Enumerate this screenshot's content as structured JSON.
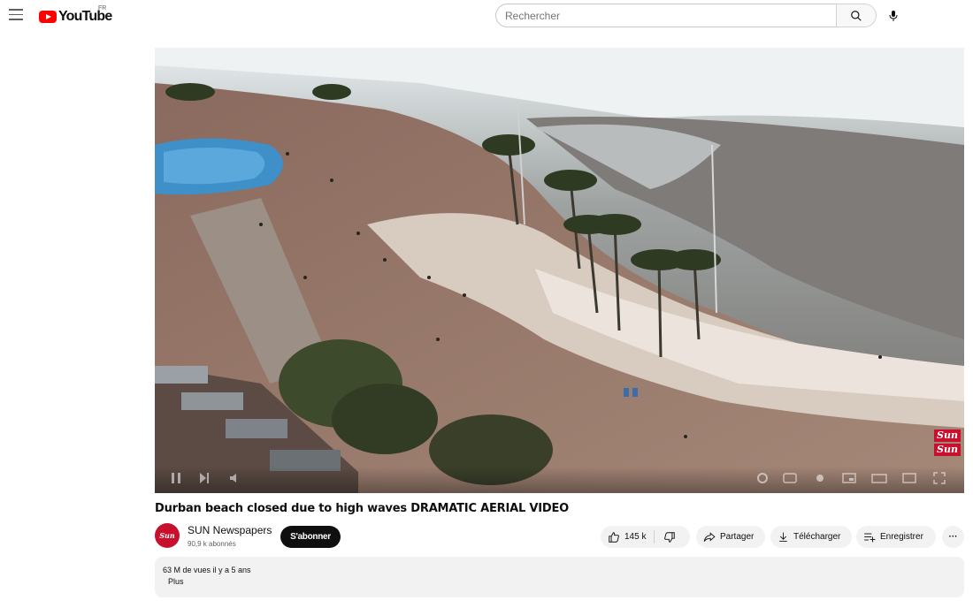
{
  "header": {
    "logo_text": "YouTube",
    "country_code": "FR",
    "search_placeholder": "Rechercher"
  },
  "video": {
    "watermark": "Sun",
    "title": "Durban beach closed due to high waves DRAMATIC AERIAL VIDEO"
  },
  "channel": {
    "name": "SUN Newspapers",
    "subscribers": "90,9 k abonnés",
    "avatar_text": "Sun",
    "subscribe_label": "S'abonner"
  },
  "actions": {
    "like_count": "145 k",
    "share_label": "Partager",
    "download_label": "Télécharger",
    "save_label": "Enregistrer",
    "more_label": "···"
  },
  "description": {
    "stats": "63 M de vues  il y a 5 ans",
    "more_label": "Plus"
  },
  "colors": {
    "brand_red": "#ff0000",
    "channel_red": "#c8102e",
    "pill_bg": "#f2f2f2"
  },
  "icons": [
    "menu-icon",
    "youtube-logo-icon",
    "search-icon",
    "mic-icon",
    "like-icon",
    "dislike-icon",
    "share-icon",
    "download-icon",
    "save-playlist-icon",
    "more-icon"
  ]
}
